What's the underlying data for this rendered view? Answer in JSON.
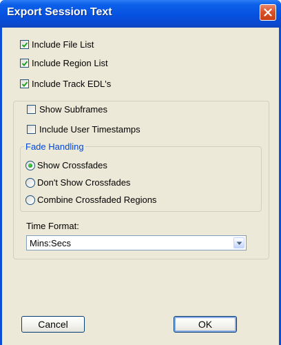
{
  "window": {
    "title": "Export Session Text"
  },
  "options": {
    "include_file_list": {
      "label": "Include File List",
      "checked": true
    },
    "include_region_list": {
      "label": "Include Region List",
      "checked": true
    },
    "include_track_edls": {
      "label": "Include Track EDL's",
      "checked": true
    }
  },
  "group": {
    "show_subframes": {
      "label": "Show Subframes",
      "checked": false
    },
    "include_user_timestamps": {
      "label": "Include User Timestamps",
      "checked": false
    },
    "fade_handling": {
      "legend": "Fade Handling",
      "selected": "show_crossfades",
      "show_crossfades": "Show Crossfades",
      "dont_show_crossfades": "Don't Show Crossfades",
      "combine_crossfaded_regions": "Combine Crossfaded Regions"
    },
    "time_format": {
      "label": "Time Format:",
      "value": "Mins:Secs"
    }
  },
  "buttons": {
    "cancel": "Cancel",
    "ok": "OK"
  },
  "icons": {
    "close": "close-icon",
    "check": "checkmark-icon",
    "dropdown": "chevron-down-icon"
  },
  "colors": {
    "title_bar": "#0651e0",
    "dialog_face": "#ece9d8",
    "close_button": "#d9532a",
    "group_legend": "#0046d5",
    "check_mark": "#21a121"
  }
}
